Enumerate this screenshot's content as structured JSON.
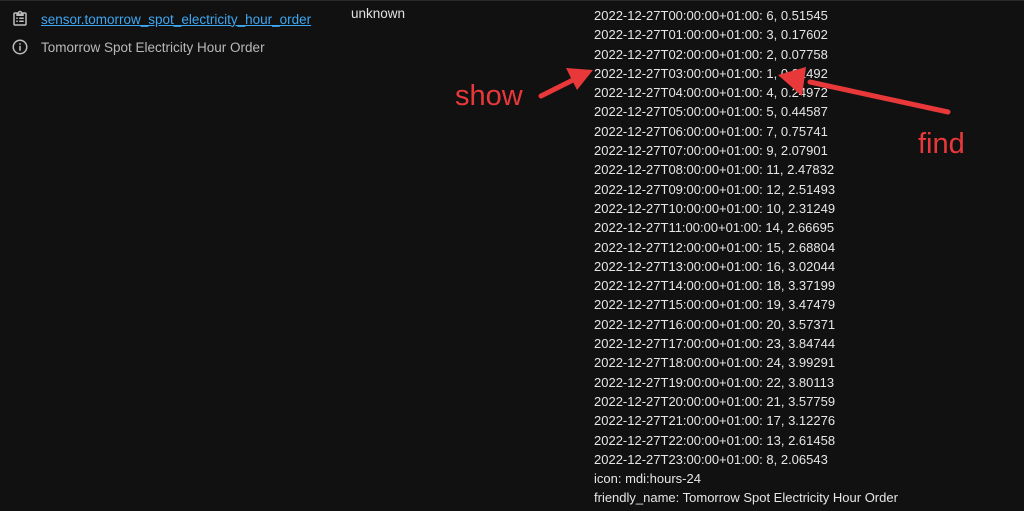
{
  "entity": {
    "id": "sensor.tomorrow_spot_electricity_hour_order",
    "friendly_name": "Tomorrow Spot Electricity Hour Order",
    "state": "unknown"
  },
  "icons": {
    "entity_icon": "clipboard-list-icon",
    "info_icon": "info-icon"
  },
  "attributes": [
    "2022-12-27T00:00:00+01:00: 6, 0.51545",
    "2022-12-27T01:00:00+01:00: 3, 0.17602",
    "2022-12-27T02:00:00+01:00: 2, 0.07758",
    "2022-12-27T03:00:00+01:00: 1, 0.02492",
    "2022-12-27T04:00:00+01:00: 4, 0.24972",
    "2022-12-27T05:00:00+01:00: 5, 0.44587",
    "2022-12-27T06:00:00+01:00: 7, 0.75741",
    "2022-12-27T07:00:00+01:00: 9, 2.07901",
    "2022-12-27T08:00:00+01:00: 11, 2.47832",
    "2022-12-27T09:00:00+01:00: 12, 2.51493",
    "2022-12-27T10:00:00+01:00: 10, 2.31249",
    "2022-12-27T11:00:00+01:00: 14, 2.66695",
    "2022-12-27T12:00:00+01:00: 15, 2.68804",
    "2022-12-27T13:00:00+01:00: 16, 3.02044",
    "2022-12-27T14:00:00+01:00: 18, 3.37199",
    "2022-12-27T15:00:00+01:00: 19, 3.47479",
    "2022-12-27T16:00:00+01:00: 20, 3.57371",
    "2022-12-27T17:00:00+01:00: 23, 3.84744",
    "2022-12-27T18:00:00+01:00: 24, 3.99291",
    "2022-12-27T19:00:00+01:00: 22, 3.80113",
    "2022-12-27T20:00:00+01:00: 21, 3.57759",
    "2022-12-27T21:00:00+01:00: 17, 3.12276",
    "2022-12-27T22:00:00+01:00: 13, 2.61458",
    "2022-12-27T23:00:00+01:00: 8, 2.06543",
    "icon: mdi:hours-24",
    "friendly_name: Tomorrow Spot Electricity Hour Order"
  ],
  "annotations": {
    "show": "show",
    "find": "find"
  },
  "colors": {
    "background": "#111111",
    "link": "#3ea7f3",
    "annotation": "#e8383a"
  }
}
